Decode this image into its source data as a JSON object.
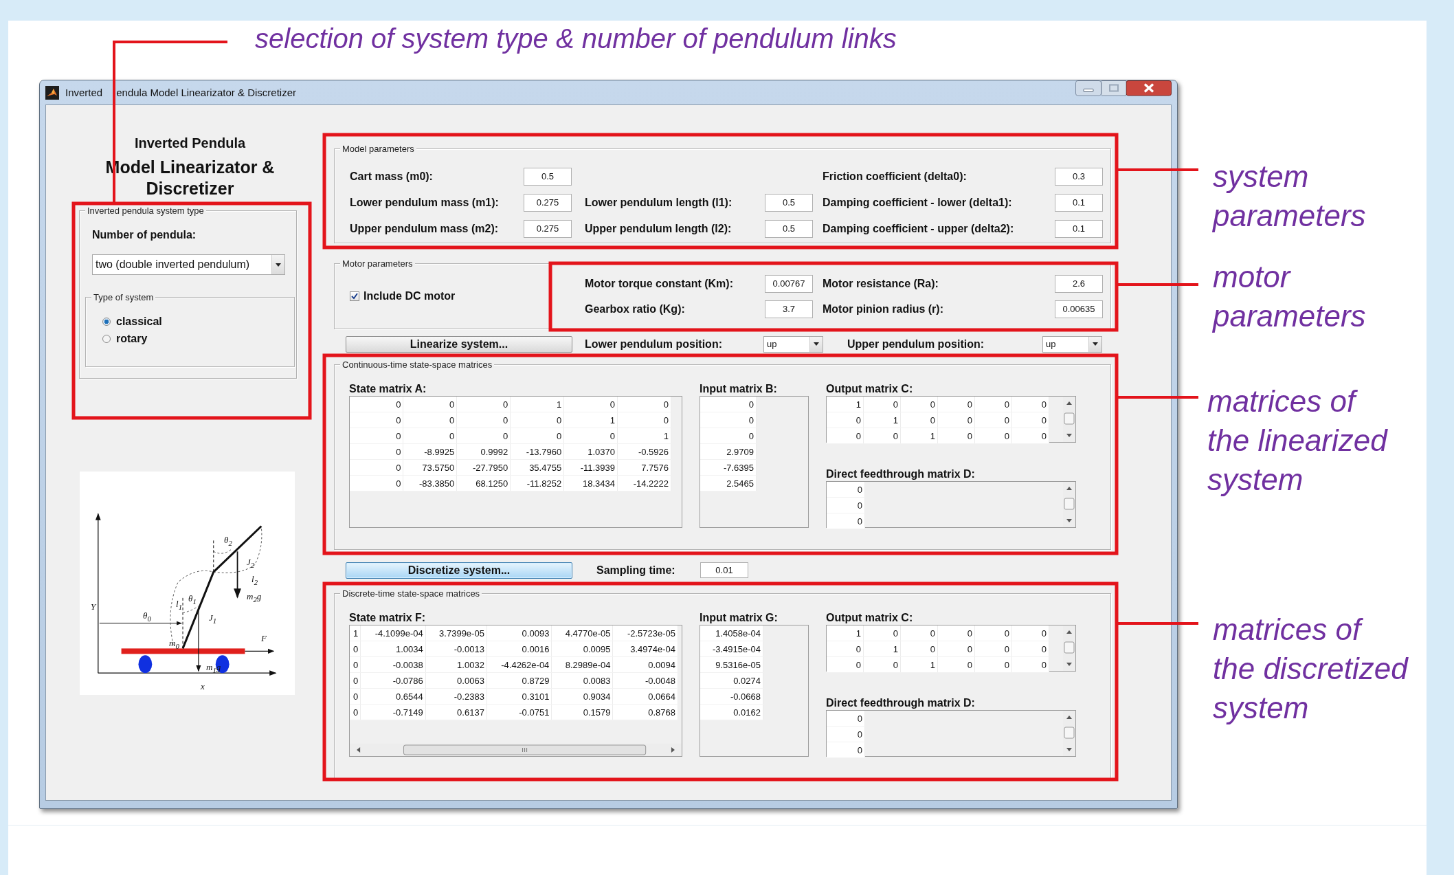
{
  "annotations": {
    "top": "selection of system type & number of pendulum links",
    "side": [
      {
        "lines": [
          "system",
          "parameters"
        ]
      },
      {
        "lines": [
          "motor",
          "parameters"
        ]
      },
      {
        "lines": [
          "matrices of",
          "the linearized",
          "system"
        ]
      },
      {
        "lines": [
          "matrices of",
          "the discretized",
          "system"
        ]
      }
    ]
  },
  "window": {
    "title": [
      "Inverted",
      "endula Model Linearizator & Discretizer"
    ]
  },
  "header": {
    "subtitle": "Inverted Pendula",
    "title": "Model Linearizator & Discretizer"
  },
  "system_type": {
    "title": "Inverted pendula system type",
    "pendula_label": "Number of pendula:",
    "pendula_value": "two (double inverted pendulum)",
    "type_group": {
      "title": "Type of system",
      "options": [
        {
          "label": "classical",
          "selected": true
        },
        {
          "label": "rotary",
          "selected": false
        }
      ]
    }
  },
  "figure": {
    "labels": [
      "Y",
      "θ$_{0}$",
      "m$_{0}$",
      "l$_{1}$",
      "θ$_{1}$",
      "J$_{1}$",
      "m$_{1}$g",
      "θ$_{2}$",
      "J$_{2}$",
      "l$_{2}$",
      "m$_{2}$g",
      "F",
      "x"
    ]
  },
  "model_parameters": {
    "title": "Model parameters",
    "columns": [
      [
        {
          "label": "Cart mass (m0):",
          "value": "0.5"
        },
        {
          "label": "Lower pendulum mass (m1):",
          "value": "0.275"
        },
        {
          "label": "Upper pendulum mass (m2):",
          "value": "0.275"
        }
      ],
      [
        {
          "label": "Lower pendulum length (l1):",
          "value": "0.5"
        },
        {
          "label": "Upper pendulum length (l2):",
          "value": "0.5"
        }
      ],
      [
        {
          "label": "Friction coefficient (delta0):",
          "value": "0.3"
        },
        {
          "label": "Damping coefficient - lower (delta1):",
          "value": "0.1"
        },
        {
          "label": "Damping coefficient - upper (delta2):",
          "value": "0.1"
        }
      ]
    ]
  },
  "motor_parameters": {
    "title": "Motor parameters",
    "include": {
      "label": "Include DC motor",
      "checked": true
    },
    "columns": [
      [
        {
          "label": "Motor torque constant (Km):",
          "value": "0.00767"
        },
        {
          "label": "Gearbox ratio (Kg):",
          "value": "3.7"
        }
      ],
      [
        {
          "label": "Motor resistance (Ra):",
          "value": "2.6"
        },
        {
          "label": "Motor pinion radius (r):",
          "value": "0.00635"
        }
      ]
    ]
  },
  "linearize": {
    "button": {
      "label": "Linearize system...",
      "focused": false
    },
    "lower_label": "Lower pendulum position:",
    "lower_value": "up",
    "upper_label": "Upper pendulum position:",
    "upper_value": "up"
  },
  "continuous": {
    "title": "Continuous-time state-space matrices",
    "matrices": [
      {
        "kind": "state",
        "label": "State matrix A:",
        "rows": [
          [
            "0",
            "0",
            "0",
            "1",
            "0",
            "0"
          ],
          [
            "0",
            "0",
            "0",
            "0",
            "1",
            "0"
          ],
          [
            "0",
            "0",
            "0",
            "0",
            "0",
            "1"
          ],
          [
            "0",
            "-8.9925",
            "0.9992",
            "-13.7960",
            "1.0370",
            "-0.5926"
          ],
          [
            "0",
            "73.5750",
            "-27.7950",
            "35.4755",
            "-11.3939",
            "7.7576"
          ],
          [
            "0",
            "-83.3850",
            "68.1250",
            "-11.8252",
            "18.3434",
            "-14.2222"
          ]
        ]
      },
      {
        "kind": "input",
        "label": "Input matrix B:",
        "rows": [
          [
            "0"
          ],
          [
            "0"
          ],
          [
            "0"
          ],
          [
            "2.9709"
          ],
          [
            "-7.6395"
          ],
          [
            "2.5465"
          ]
        ]
      },
      {
        "kind": "output",
        "label": "Output matrix C:",
        "rows": [
          [
            "1",
            "0",
            "0",
            "0",
            "0",
            "0"
          ],
          [
            "0",
            "1",
            "0",
            "0",
            "0",
            "0"
          ],
          [
            "0",
            "0",
            "1",
            "0",
            "0",
            "0"
          ]
        ]
      },
      {
        "kind": "feedthrough",
        "label": "Direct feedthrough matrix D:",
        "rows": [
          [
            "0"
          ],
          [
            "0"
          ],
          [
            "0"
          ]
        ]
      }
    ]
  },
  "discretize": {
    "button": {
      "label": "Discretize system...",
      "focused": true
    },
    "sampling_label": "Sampling time:",
    "sampling_value": "0.01"
  },
  "discrete": {
    "title": "Discrete-time state-space matrices",
    "matrices": [
      {
        "kind": "state",
        "label": "State matrix F:",
        "rows": [
          [
            "1",
            "-4.1099e-04",
            "3.7399e-05",
            "0.0093",
            "4.4770e-05",
            "-2.5723e-05"
          ],
          [
            "0",
            "1.0034",
            "-0.0013",
            "0.0016",
            "0.0095",
            "3.4974e-04"
          ],
          [
            "0",
            "-0.0038",
            "1.0032",
            "-4.4262e-04",
            "8.2989e-04",
            "0.0094"
          ],
          [
            "0",
            "-0.0786",
            "0.0063",
            "0.8729",
            "0.0083",
            "-0.0048"
          ],
          [
            "0",
            "0.6544",
            "-0.2383",
            "0.3101",
            "0.9034",
            "0.0664"
          ],
          [
            "0",
            "-0.7149",
            "0.6137",
            "-0.0751",
            "0.1579",
            "0.8768"
          ]
        ]
      },
      {
        "kind": "input",
        "label": "Input matrix G:",
        "rows": [
          [
            "1.4058e-04"
          ],
          [
            "-3.4915e-04"
          ],
          [
            "9.5316e-05"
          ],
          [
            "0.0274"
          ],
          [
            "-0.0668"
          ],
          [
            "0.0162"
          ]
        ]
      },
      {
        "kind": "output",
        "label": "Output matrix C:",
        "rows": [
          [
            "1",
            "0",
            "0",
            "0",
            "0",
            "0"
          ],
          [
            "0",
            "1",
            "0",
            "0",
            "0",
            "0"
          ],
          [
            "0",
            "0",
            "1",
            "0",
            "0",
            "0"
          ]
        ]
      },
      {
        "kind": "feedthrough",
        "label": "Direct feedthrough matrix D:",
        "rows": [
          [
            "0"
          ],
          [
            "0"
          ],
          [
            "0"
          ]
        ]
      }
    ]
  }
}
